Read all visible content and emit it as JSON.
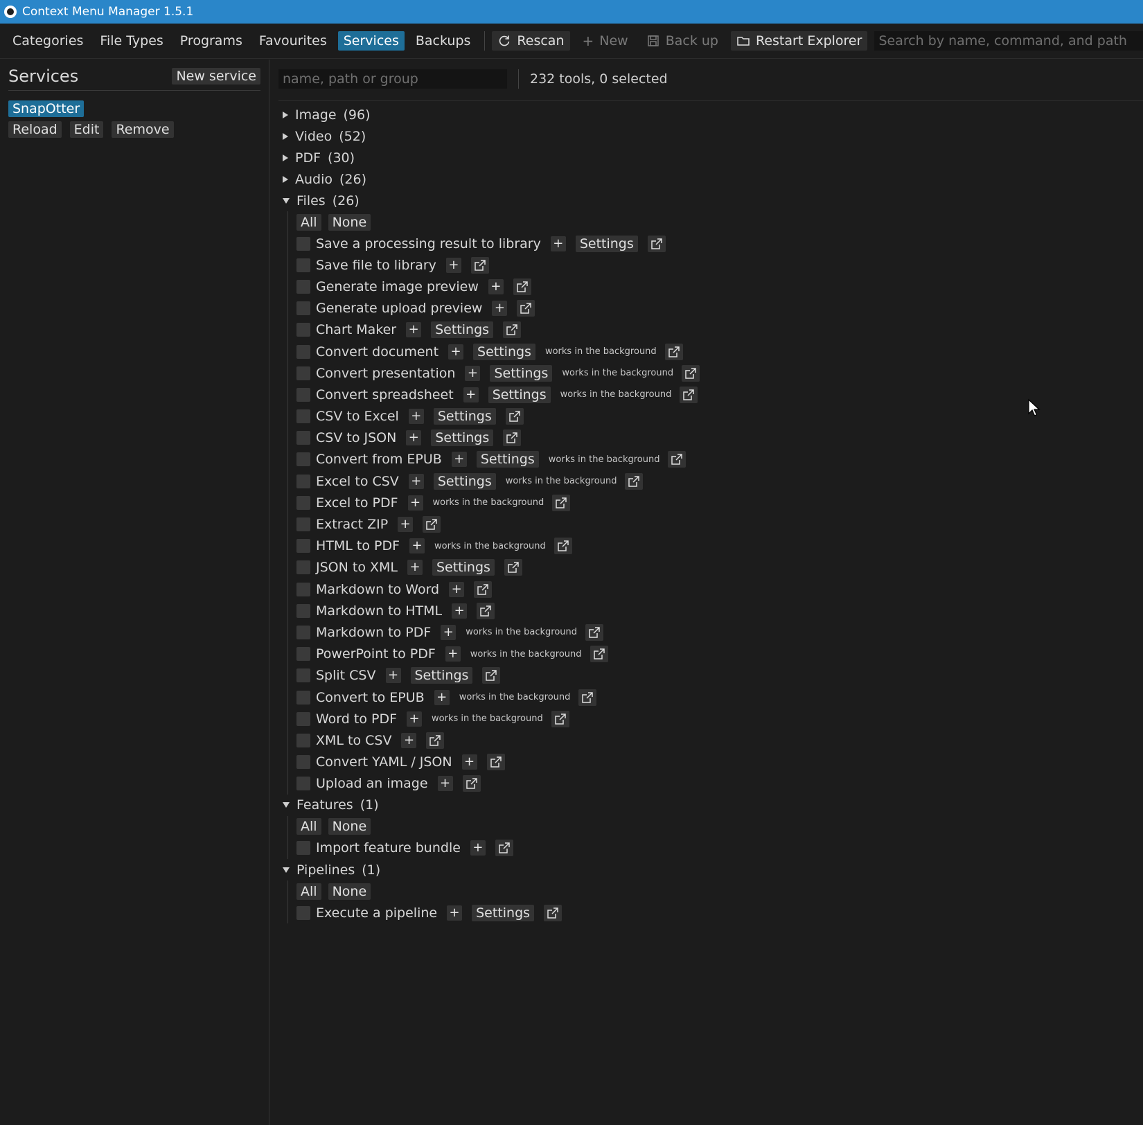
{
  "window": {
    "title": "Context Menu Manager 1.5.1"
  },
  "menubar": {
    "tabs": [
      {
        "label": "Categories",
        "active": false
      },
      {
        "label": "File Types",
        "active": false
      },
      {
        "label": "Programs",
        "active": false
      },
      {
        "label": "Favourites",
        "active": false
      },
      {
        "label": "Services",
        "active": true
      },
      {
        "label": "Backups",
        "active": false
      }
    ],
    "rescan_label": "Rescan",
    "new_label": "New",
    "backup_label": "Back up",
    "restart_label": "Restart Explorer",
    "search_placeholder": "Search by name, command, and path"
  },
  "sidebar": {
    "title": "Services",
    "new_service_label": "New service",
    "selected_service": "SnapOtter",
    "reload_label": "Reload",
    "edit_label": "Edit",
    "remove_label": "Remove"
  },
  "content": {
    "filter_placeholder": "name, path or group",
    "count_text": "232 tools, 0 selected",
    "all_label": "All",
    "none_label": "None",
    "settings_label": "Settings",
    "background_note": "works in the background"
  },
  "categories": [
    {
      "name": "Image",
      "count": "(96)",
      "expanded": false,
      "tools": []
    },
    {
      "name": "Video",
      "count": "(52)",
      "expanded": false,
      "tools": []
    },
    {
      "name": "PDF",
      "count": "(30)",
      "expanded": false,
      "tools": []
    },
    {
      "name": "Audio",
      "count": "(26)",
      "expanded": false,
      "tools": []
    },
    {
      "name": "Files",
      "count": "(26)",
      "expanded": true,
      "tools": [
        {
          "name": "Save a processing result to library",
          "settings": true,
          "background": false
        },
        {
          "name": "Save file to library",
          "settings": false,
          "background": false
        },
        {
          "name": "Generate image preview",
          "settings": false,
          "background": false
        },
        {
          "name": "Generate upload preview",
          "settings": false,
          "background": false
        },
        {
          "name": "Chart Maker",
          "settings": true,
          "background": false
        },
        {
          "name": "Convert document",
          "settings": true,
          "background": true
        },
        {
          "name": "Convert presentation",
          "settings": true,
          "background": true
        },
        {
          "name": "Convert spreadsheet",
          "settings": true,
          "background": true
        },
        {
          "name": "CSV to Excel",
          "settings": true,
          "background": false
        },
        {
          "name": "CSV to JSON",
          "settings": true,
          "background": false
        },
        {
          "name": "Convert from EPUB",
          "settings": true,
          "background": true
        },
        {
          "name": "Excel to CSV",
          "settings": true,
          "background": true
        },
        {
          "name": "Excel to PDF",
          "settings": false,
          "background": true
        },
        {
          "name": "Extract ZIP",
          "settings": false,
          "background": false
        },
        {
          "name": "HTML to PDF",
          "settings": false,
          "background": true
        },
        {
          "name": "JSON to XML",
          "settings": true,
          "background": false
        },
        {
          "name": "Markdown to Word",
          "settings": false,
          "background": false
        },
        {
          "name": "Markdown to HTML",
          "settings": false,
          "background": false
        },
        {
          "name": "Markdown to PDF",
          "settings": false,
          "background": true
        },
        {
          "name": "PowerPoint to PDF",
          "settings": false,
          "background": true
        },
        {
          "name": "Split CSV",
          "settings": true,
          "background": false
        },
        {
          "name": "Convert to EPUB",
          "settings": false,
          "background": true
        },
        {
          "name": "Word to PDF",
          "settings": false,
          "background": true
        },
        {
          "name": "XML to CSV",
          "settings": false,
          "background": false
        },
        {
          "name": "Convert YAML / JSON",
          "settings": false,
          "background": false
        },
        {
          "name": "Upload an image",
          "settings": false,
          "background": false
        }
      ]
    },
    {
      "name": "Features",
      "count": "(1)",
      "expanded": true,
      "tools": [
        {
          "name": "Import feature bundle",
          "settings": false,
          "background": false
        }
      ]
    },
    {
      "name": "Pipelines",
      "count": "(1)",
      "expanded": true,
      "tools": [
        {
          "name": "Execute a pipeline",
          "settings": true,
          "background": false
        }
      ]
    }
  ],
  "colors": {
    "titlebar": "#2a86c9",
    "accent": "#1e6e98",
    "background": "#1c1c1c",
    "button": "#333333"
  }
}
